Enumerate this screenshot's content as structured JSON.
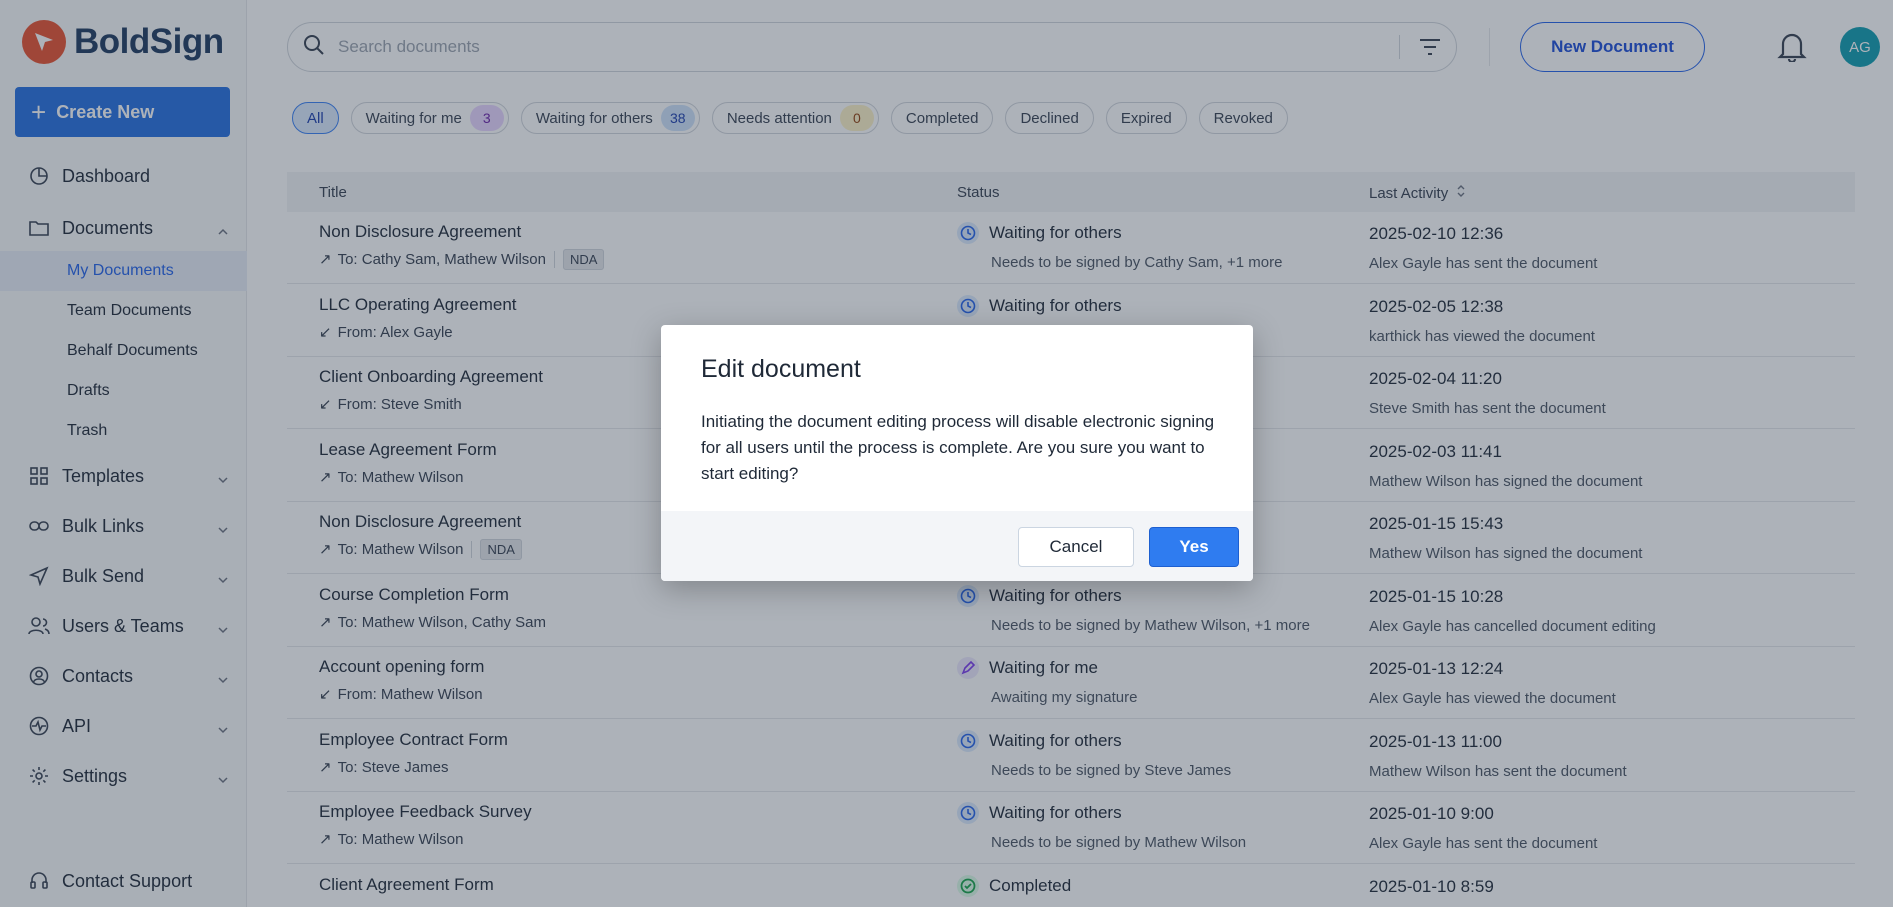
{
  "app": {
    "name": "BoldSign",
    "brand_color": "#e8522f",
    "accent_color": "#2670e0"
  },
  "sidebar": {
    "create_label": "Create New",
    "items": [
      {
        "label": "Dashboard",
        "icon": "dashboard-icon"
      },
      {
        "label": "Documents",
        "icon": "folder-icon"
      },
      {
        "label": "Templates",
        "icon": "grid-icon"
      },
      {
        "label": "Bulk Links",
        "icon": "link-icon"
      },
      {
        "label": "Bulk Send",
        "icon": "send-icon"
      },
      {
        "label": "Users & Teams",
        "icon": "users-icon"
      },
      {
        "label": "Contacts",
        "icon": "contact-icon"
      },
      {
        "label": "API",
        "icon": "api-icon"
      },
      {
        "label": "Settings",
        "icon": "gear-icon"
      }
    ],
    "sub_items": [
      "My Documents",
      "Team Documents",
      "Behalf Documents",
      "Drafts",
      "Trash"
    ],
    "support_label": "Contact Support"
  },
  "header": {
    "search_placeholder": "Search documents",
    "new_document_label": "New Document",
    "avatar_initials": "AG"
  },
  "filters": [
    {
      "label": "All"
    },
    {
      "label": "Waiting for me",
      "count": "3"
    },
    {
      "label": "Waiting for others",
      "count": "38"
    },
    {
      "label": "Needs attention",
      "count": "0"
    },
    {
      "label": "Completed"
    },
    {
      "label": "Declined"
    },
    {
      "label": "Expired"
    },
    {
      "label": "Revoked"
    }
  ],
  "table": {
    "headers": {
      "title": "Title",
      "status": "Status",
      "last_activity": "Last Activity"
    },
    "rows": [
      {
        "title": "Non Disclosure Agreement",
        "recipients": "To: Cathy Sam, Mathew Wilson",
        "tag": "NDA",
        "status": "Waiting for others",
        "status_detail": "Needs to be signed by Cathy Sam, +1 more",
        "date": "2025-02-10 12:36",
        "activity": "Alex Gayle has sent the document"
      },
      {
        "title": "LLC Operating Agreement",
        "recipients": "From: Alex Gayle",
        "status": "Waiting for others",
        "status_detail": "",
        "date": "2025-02-05 12:38",
        "activity": "karthick has viewed the document"
      },
      {
        "title": "Client Onboarding Agreement",
        "recipients": "From: Steve Smith",
        "status": "",
        "status_detail": "",
        "date": "2025-02-04 11:20",
        "activity": "Steve Smith has sent the document"
      },
      {
        "title": "Lease Agreement Form",
        "recipients": "To: Mathew Wilson",
        "status": "",
        "status_detail": "",
        "date": "2025-02-03 11:41",
        "activity": "Mathew Wilson has signed the document"
      },
      {
        "title": "Non Disclosure Agreement",
        "recipients": "To: Mathew Wilson",
        "tag": "NDA",
        "status": "",
        "status_detail": "",
        "date": "2025-01-15 15:43",
        "activity": "Mathew Wilson has signed the document"
      },
      {
        "title": "Course Completion Form",
        "recipients": "To: Mathew Wilson, Cathy Sam",
        "status": "Waiting for others",
        "status_detail": "Needs to be signed by Mathew Wilson, +1 more",
        "date": "2025-01-15 10:28",
        "activity": "Alex Gayle has cancelled document editing"
      },
      {
        "title": "Account opening form",
        "recipients": "From: Mathew Wilson",
        "status": "Waiting for me",
        "status_detail": "Awaiting my signature",
        "date": "2025-01-13 12:24",
        "activity": "Alex Gayle has viewed the document"
      },
      {
        "title": "Employee Contract Form",
        "recipients": "To: Steve James",
        "status": "Waiting for others",
        "status_detail": "Needs to be signed by Steve James",
        "date": "2025-01-13 11:00",
        "activity": "Mathew Wilson has sent the document"
      },
      {
        "title": "Employee Feedback Survey",
        "recipients": "To: Mathew Wilson",
        "status": "Waiting for others",
        "status_detail": "Needs to be signed by Mathew Wilson",
        "date": "2025-01-10 9:00",
        "activity": "Alex Gayle has sent the document"
      },
      {
        "title": "Client Agreement Form",
        "recipients": "",
        "status": "Completed",
        "status_detail": "",
        "date": "2025-01-10 8:59",
        "activity": ""
      }
    ]
  },
  "modal": {
    "title": "Edit document",
    "message": "Initiating the document editing process will disable electronic signing for all users until the process is complete. Are you sure you want to start editing?",
    "cancel_label": "Cancel",
    "confirm_label": "Yes"
  }
}
